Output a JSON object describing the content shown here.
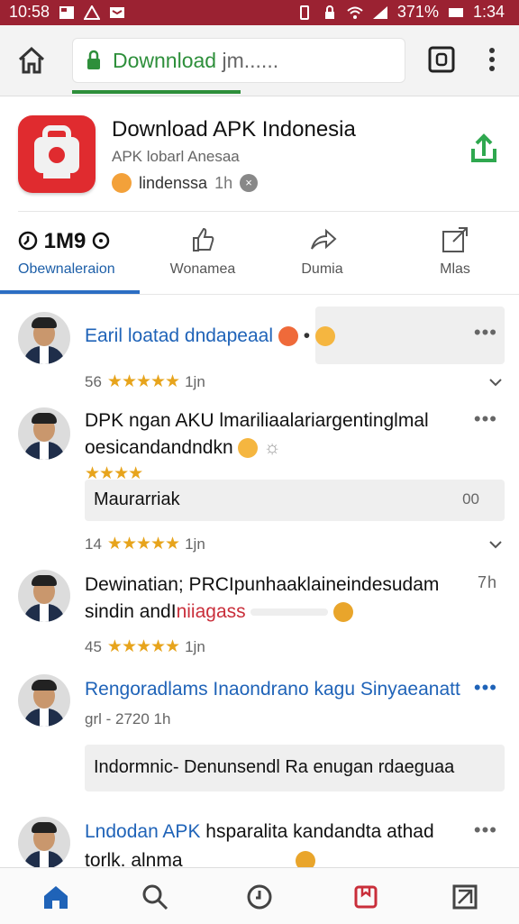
{
  "status_bar": {
    "left_time": "10:58",
    "battery": "371%",
    "time": "1:34"
  },
  "browser": {
    "url_text": "Downnload",
    "url_tail": " jm......"
  },
  "app": {
    "title": "Download APK Indonesia",
    "subtitle": "APK lobarl Anesaa",
    "meta_text": "lindenssa",
    "meta_time": "1h"
  },
  "actions": [
    {
      "label": "Obewnaleraion",
      "value": "1M9"
    },
    {
      "label": "Wonamea"
    },
    {
      "label": "Dumia"
    },
    {
      "label": "Mlas"
    }
  ],
  "comments": [
    {
      "text": "Earil loatad dndapeaal",
      "count": "56",
      "time": "1jn",
      "stars": "★★★★★"
    },
    {
      "line1": "DPK ngan AKU lmariliaalariargentinglmal",
      "line2": "oesicandandndkn",
      "stars": "★★★★",
      "reply": "Maurarriak",
      "reply_right": "00",
      "count": "14",
      "time": "1jn",
      "stars2": "★★★★★"
    },
    {
      "line1": "Dewinatian; PRCIpunhaaklaineindesudam",
      "line1_right": "7h",
      "line2_a": "sindin andI",
      "line2_b": "niiagass",
      "count": "45",
      "time": "1jn",
      "stars": "★★★★★"
    },
    {
      "line1": "Rengoradlams Inaondrano kagu Sinyaeanatt",
      "meta": "grl - 2720 1h",
      "reply": "Indormnic- Denunsendl Ra enugan rdaeguaa"
    },
    {
      "line1_a": "Lndodan APK ",
      "line1_b": "hsparalita kandandta athad",
      "line2": "torlk. alnma"
    }
  ]
}
